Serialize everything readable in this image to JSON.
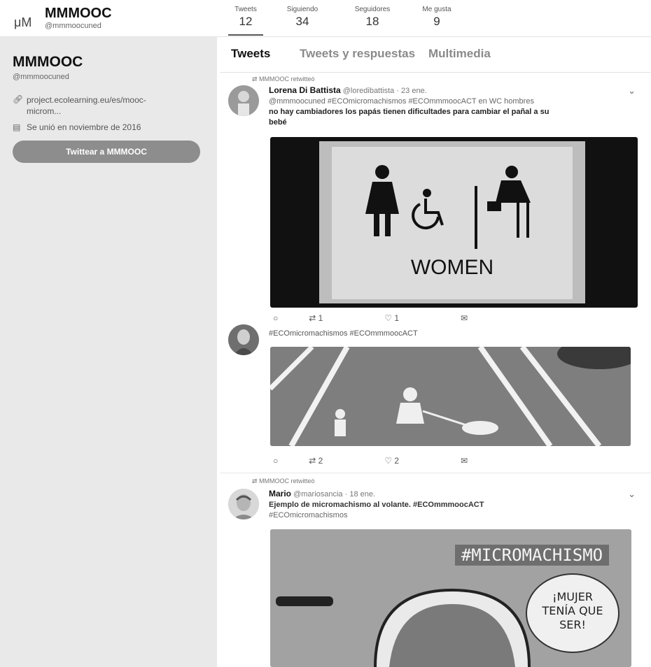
{
  "header": {
    "logo": "μM",
    "account_name": "MMMOOC",
    "account_handle": "@mmmoocuned",
    "stats": [
      {
        "label": "Tweets",
        "value": "12"
      },
      {
        "label": "Siguiendo",
        "value": "34"
      },
      {
        "label": "Seguidores",
        "value": "18"
      },
      {
        "label": "Me gusta",
        "value": "9"
      }
    ]
  },
  "sidebar": {
    "name": "MMMOOC",
    "handle": "@mmmoocuned",
    "link_line1": "project.ecolearning.eu/es/mooc-",
    "link_line2": "microm...",
    "joined": "Se unió en noviembre de 2016",
    "tweet_button": "Twittear a MMMOOC"
  },
  "tabs": [
    "Tweets",
    "Tweets y respuestas",
    "Multimedia"
  ],
  "tweets": [
    {
      "retweet_label": "MMMOOC retwitteó",
      "name": "Lorena Di Battista",
      "handle_date": "@loredibattista · 23 ene.",
      "text_line1": "@mmmoocuned #ECOmicromachismos #ECOmmmoocACT en  WC hombres",
      "text_line2": "no hay cambiadores los papás tienen dificultades para cambiar el pañal a su",
      "text_line3": "bebé",
      "image_text": "WOMEN",
      "replies": "",
      "retweets": "1",
      "likes": "1"
    },
    {
      "text_line1": "#ECOmicromachismos #ECOmmmoocACT",
      "replies": "",
      "retweets": "2",
      "likes": "2"
    },
    {
      "retweet_label": "MMMOOC retwitteó",
      "name": "Mario",
      "handle_date": "@mariosancia · 18 ene.",
      "text_line1": "Ejemplo de micromachismo al volante. #ECOmmmoocACT",
      "text_line2": "#ECOmicromachismos",
      "image_hashtag": "#MICROMACHISMO",
      "speech_line1": "¡MUJER",
      "speech_line2": "TENÍA QUE",
      "speech_line3": "SER!"
    }
  ],
  "icons": {
    "reply": "reply-icon",
    "retweet": "retweet-icon",
    "like": "heart-icon",
    "dm": "message-icon"
  }
}
